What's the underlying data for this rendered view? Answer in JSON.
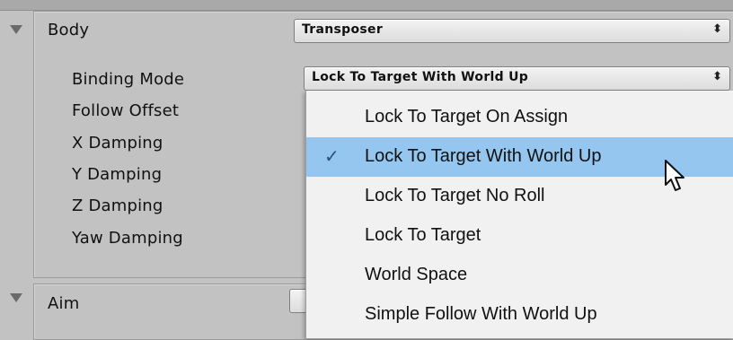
{
  "body_section": {
    "title": "Body",
    "component_value": "Transposer",
    "properties": [
      {
        "label": "Binding Mode"
      },
      {
        "label": "Follow Offset"
      },
      {
        "label": "X Damping"
      },
      {
        "label": "Y Damping"
      },
      {
        "label": "Z Damping"
      },
      {
        "label": "Yaw Damping"
      }
    ],
    "binding_mode_value": "Lock To Target With World Up"
  },
  "aim_section": {
    "title": "Aim"
  },
  "dropdown": {
    "options": [
      {
        "label": "Lock To Target On Assign",
        "selected": false
      },
      {
        "label": "Lock To Target With World Up",
        "selected": true
      },
      {
        "label": "Lock To Target No Roll",
        "selected": false
      },
      {
        "label": "Lock To Target",
        "selected": false
      },
      {
        "label": "World Space",
        "selected": false
      },
      {
        "label": "Simple Follow With World Up",
        "selected": false
      }
    ],
    "check_glyph": "✓",
    "selected_color": "#94c6ef"
  },
  "icons": {
    "popup_arrows": "⬍",
    "foldout": "triangle-down"
  }
}
